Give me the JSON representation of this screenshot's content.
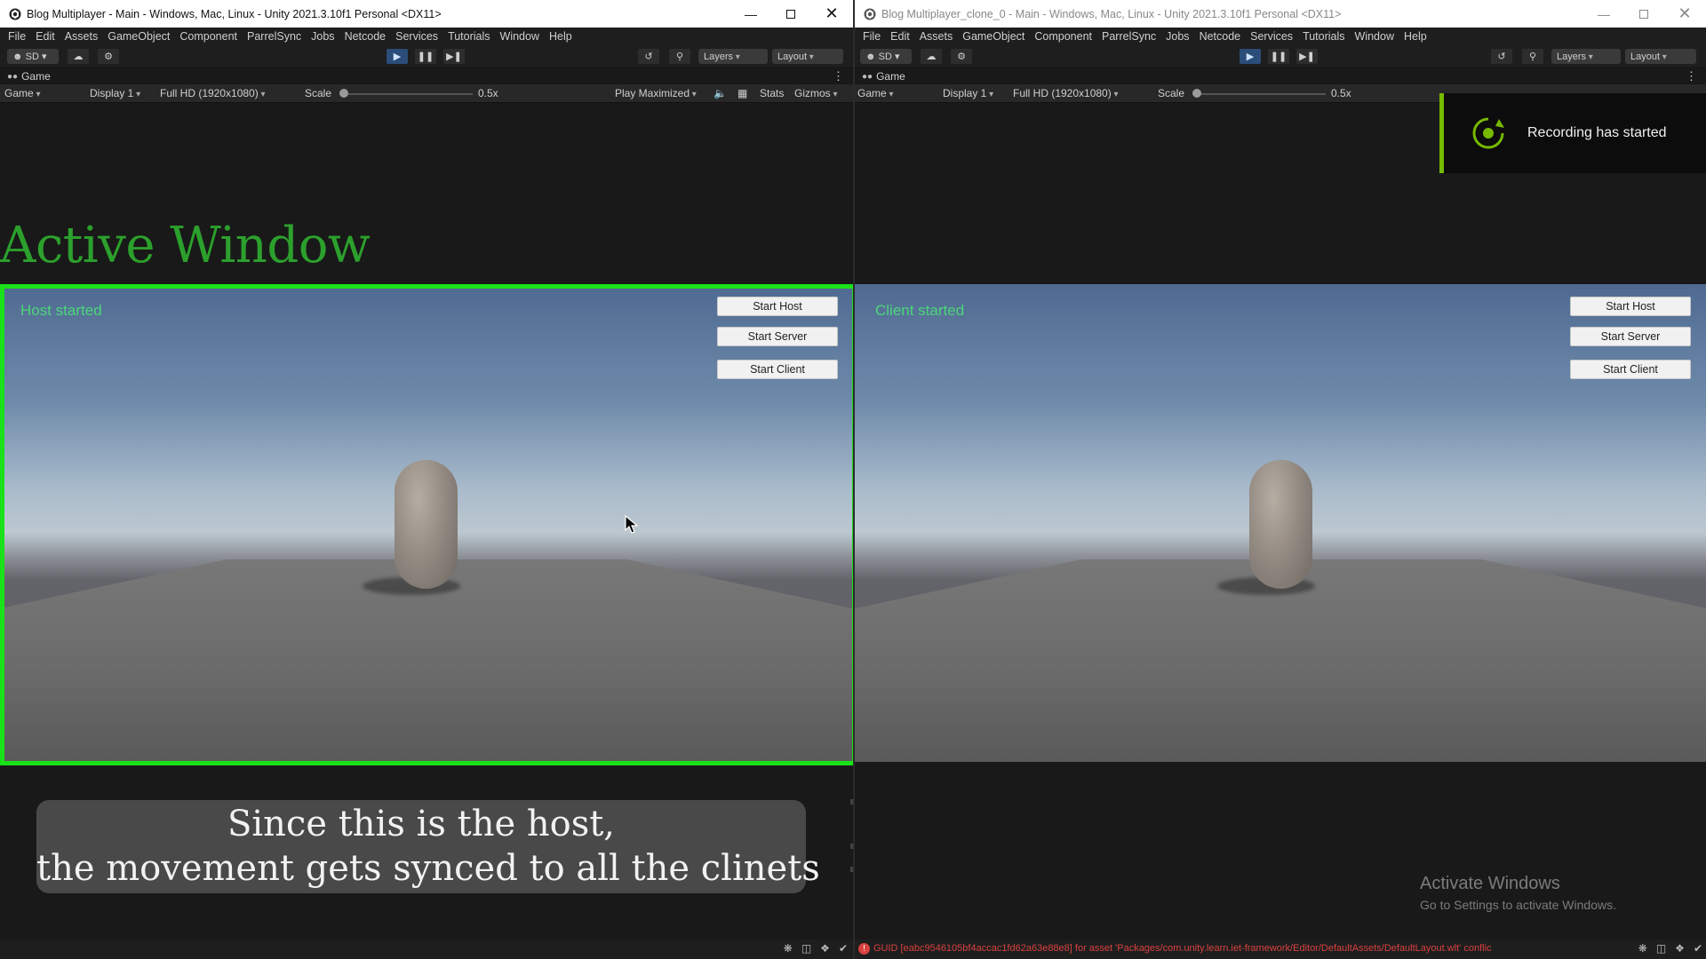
{
  "colors": {
    "accent_play": "#2b4d79",
    "status_green": "#4cd67a",
    "highlight_border": "#19e219",
    "active_label": "#2ca02c",
    "toast_accent": "#76b900",
    "error_red": "#d8413f"
  },
  "menu": [
    "File",
    "Edit",
    "Assets",
    "GameObject",
    "Component",
    "ParrelSync",
    "Jobs",
    "Netcode",
    "Services",
    "Tutorials",
    "Window",
    "Help"
  ],
  "toolbar": {
    "account": "SD",
    "layers": "Layers",
    "layout": "Layout"
  },
  "left": {
    "title": "Blog Multiplayer - Main - Windows, Mac, Linux - Unity 2021.3.10f1 Personal <DX11>",
    "tab": "Game",
    "gamebar": {
      "view": "Game",
      "display": "Display 1",
      "resolution": "Full HD (1920x1080)",
      "scale_label": "Scale",
      "scale_value": "0.5x",
      "play_mode": "Play Maximized",
      "stats": "Stats",
      "gizmos": "Gizmos"
    },
    "status": "Host started",
    "buttons": {
      "host": "Start Host",
      "server": "Start Server",
      "client": "Start Client"
    },
    "active_label": "Active Window",
    "subtitle": {
      "line1": "Since this is the host,",
      "line2": "the movement gets synced to all the clinets"
    }
  },
  "right": {
    "title": "Blog Multiplayer_clone_0 - Main - Windows, Mac, Linux - Unity 2021.3.10f1 Personal <DX11>",
    "tab": "Game",
    "gamebar": {
      "view": "Game",
      "display": "Display 1",
      "resolution": "Full HD (1920x1080)",
      "scale_label": "Scale",
      "scale_value": "0.5x"
    },
    "status": "Client started",
    "buttons": {
      "host": "Start Host",
      "server": "Start Server",
      "client": "Start Client"
    },
    "error": "GUID [eabc9546105bf4accac1fd62a63e88e8] for asset 'Packages/com.unity.learn.iet-framework/Editor/DefaultAssets/DefaultLayout.wlt' conflic"
  },
  "toast": {
    "message": "Recording has started"
  },
  "watermark": {
    "line1": "Activate Windows",
    "line2": "Go to Settings to activate Windows."
  }
}
